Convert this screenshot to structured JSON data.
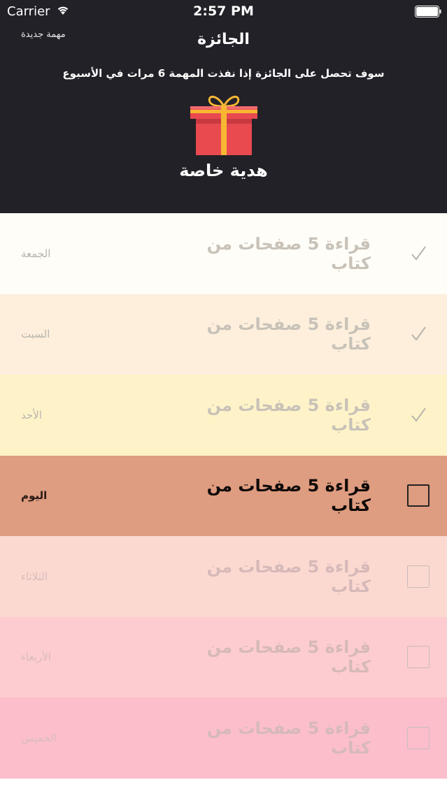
{
  "status_bar": {
    "carrier": "Carrier",
    "time": "2:57 PM"
  },
  "header": {
    "new_task_label": "مهمة جديدة",
    "title": "الجائزة",
    "description": "سوف تحصل على الجائزة إذا نفذت المهمة 6 مرات في الأسبوع",
    "gift_label": "هدية خاصة",
    "background_color": "#222128"
  },
  "rows": [
    {
      "day": "الجمعة",
      "task": "قراءة 5 صفحات من كتاب",
      "state": "checked",
      "background": "#fefdf8"
    },
    {
      "day": "السبت",
      "task": "قراءة 5 صفحات من كتاب",
      "state": "checked",
      "background": "#fdefdc"
    },
    {
      "day": "الأحد",
      "task": "قراءة 5 صفحات من كتاب",
      "state": "checked",
      "background": "#fef3c8"
    },
    {
      "day": "اليوم",
      "task": "قراءة 5 صفحات من كتاب",
      "state": "unchecked-active",
      "background": "#de9c80"
    },
    {
      "day": "الثلاثاء",
      "task": "قراءة 5 صفحات من كتاب",
      "state": "unchecked",
      "background": "#fcd9d0"
    },
    {
      "day": "الأربعاء",
      "task": "قراءة 5 صفحات من كتاب",
      "state": "unchecked",
      "background": "#fdccd0"
    },
    {
      "day": "الخميس",
      "task": "قراءة 5 صفحات من كتاب",
      "state": "unchecked",
      "background": "#fcbecb"
    }
  ],
  "icons": {
    "checked": "checkmark-icon",
    "unchecked": "checkbox-empty-icon",
    "gift": "gift-box-icon",
    "wifi": "wifi-icon",
    "battery": "battery-icon"
  }
}
